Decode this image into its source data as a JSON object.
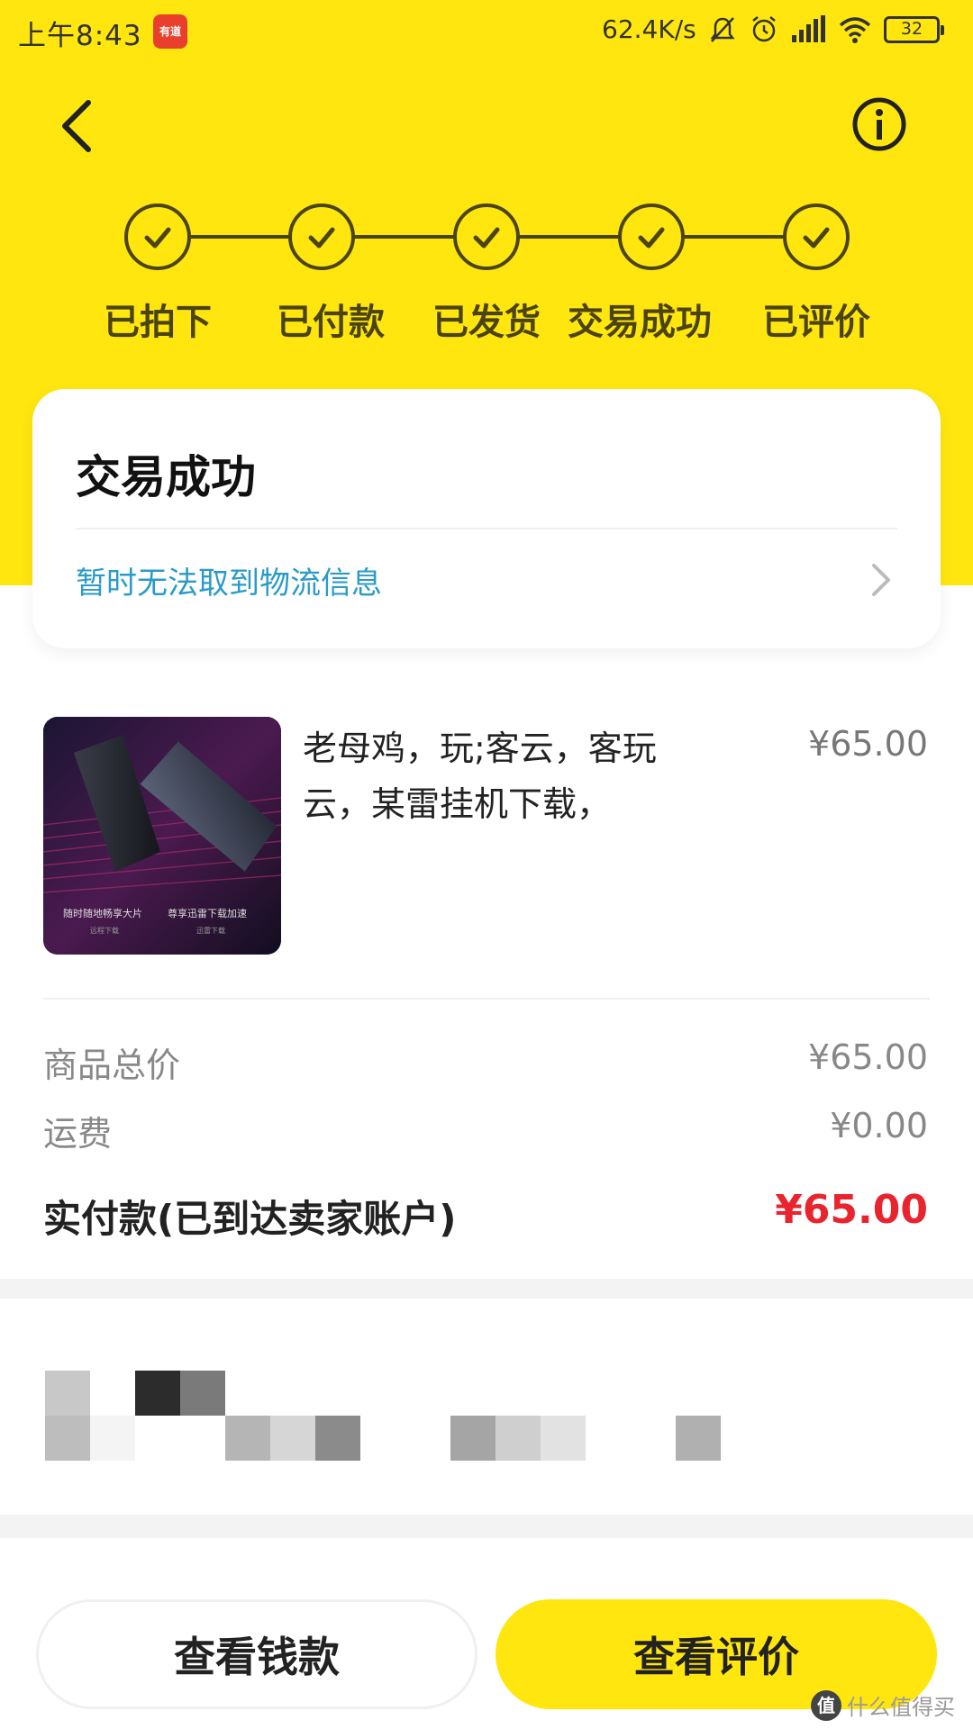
{
  "status_bar": {
    "time": "上午8:43",
    "app_badge": "有道",
    "net_speed": "62.4K/s",
    "battery": "32"
  },
  "steps": [
    {
      "label": "已拍下"
    },
    {
      "label": "已付款"
    },
    {
      "label": "已发货"
    },
    {
      "label": "交易成功"
    },
    {
      "label": "已评价"
    }
  ],
  "status_card": {
    "title": "交易成功",
    "logistics": "暂时无法取到物流信息"
  },
  "product": {
    "title": "老母鸡，玩;客云，客玩云，某雷挂机下载，",
    "price": "¥65.00",
    "image_caption_left": "随时随地畅享大片",
    "image_caption_right": "尊享迅雷下载加速",
    "image_subcaption_left": "远程下载",
    "image_subcaption_right": "迅雷下载"
  },
  "summary": {
    "subtotal_label": "商品总价",
    "subtotal_value": "¥65.00",
    "shipping_label": "运费",
    "shipping_value": "¥0.00",
    "paid_label": "实付款(已到达卖家账户)",
    "paid_value": "¥65.00"
  },
  "actions": {
    "view_money": "查看钱款",
    "view_review": "查看评价"
  },
  "watermark": {
    "icon": "值",
    "text": "什么值得买"
  },
  "colors": {
    "accent_yellow": "#ffe60f",
    "step_dark": "#4b4410",
    "link_blue": "#2a9bc9",
    "price_red": "#e8242f"
  }
}
